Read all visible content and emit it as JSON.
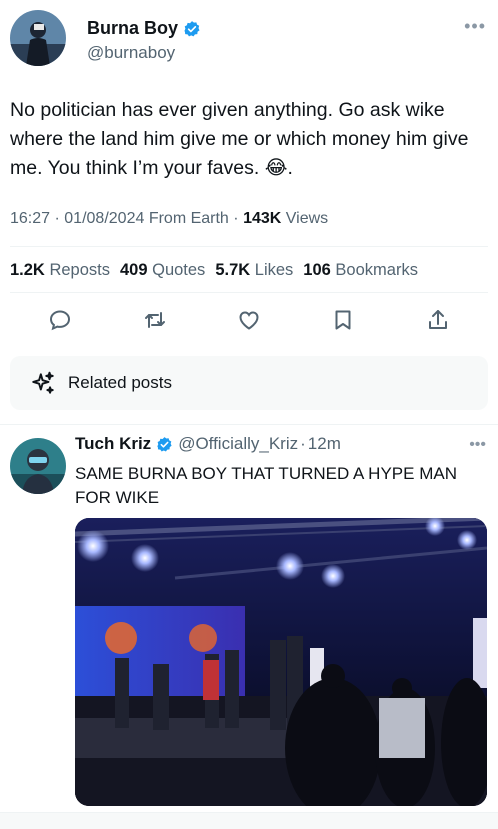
{
  "tweet": {
    "author_name": "Burna Boy",
    "author_handle": "@burnaboy",
    "text": "No politician has ever given anything. Go ask wike where the land him give me or which money him give me. You think I’m your faves. 😂.",
    "time": "16:27",
    "date": "01/08/2024",
    "source": "From Earth",
    "views_count": "143K",
    "views_label": "Views",
    "reposts_count": "1.2K",
    "reposts_label": "Reposts",
    "quotes_count": "409",
    "quotes_label": "Quotes",
    "likes_count": "5.7K",
    "likes_label": "Likes",
    "bookmarks_count": "106",
    "bookmarks_label": "Bookmarks"
  },
  "actions": {
    "icons": [
      "reply-icon",
      "repost-icon",
      "like-icon",
      "bookmark-icon",
      "share-icon"
    ]
  },
  "related": {
    "label": "Related posts"
  },
  "reply": {
    "author_name": "Tuch Kriz",
    "author_handle": "@Officially_Kriz",
    "time": "12m",
    "text": "SAME BURNA BOY THAT TURNED A HYPE MAN FOR WIKE"
  },
  "colors": {
    "text": "#0f1419",
    "secondary": "#536471",
    "verified": "#1d9bf0",
    "divider": "#eff3f4",
    "panel": "#f7f9f9"
  }
}
